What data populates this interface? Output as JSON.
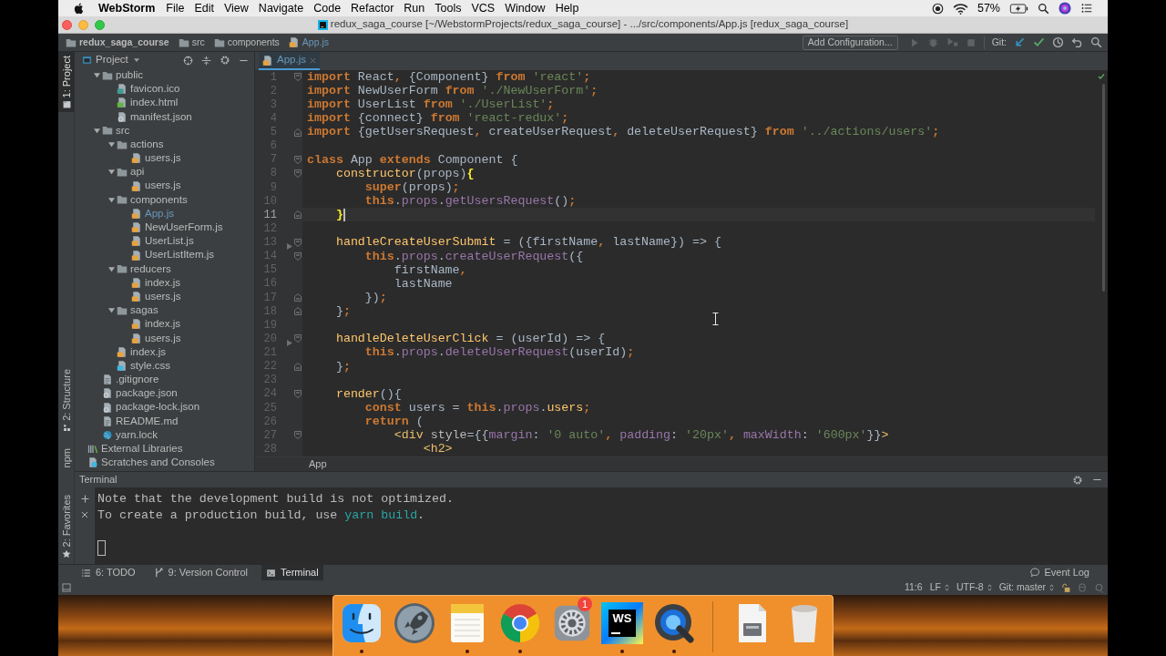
{
  "menu_bar": {
    "app_name": "WebStorm",
    "menus": [
      "File",
      "Edit",
      "View",
      "Navigate",
      "Code",
      "Refactor",
      "Run",
      "Tools",
      "VCS",
      "Window",
      "Help"
    ],
    "battery": "57%"
  },
  "window": {
    "title": "redux_saga_course [~/WebstormProjects/redux_saga_course] - .../src/components/App.js [redux_saga_course]"
  },
  "navigation_bar": {
    "breadcrumbs": [
      {
        "label": "redux_saga_course",
        "kind": "project",
        "modified": false
      },
      {
        "label": "src",
        "kind": "folder",
        "modified": false
      },
      {
        "label": "components",
        "kind": "folder",
        "modified": false
      },
      {
        "label": "App.js",
        "kind": "js",
        "modified": true
      }
    ],
    "run_configuration": "Add Configuration...",
    "git_label": "Git:"
  },
  "tool_stripe": {
    "top": [
      {
        "label": "1: Project",
        "kind": "project",
        "selected": true
      }
    ],
    "bottom": [
      {
        "label": "2: Structure",
        "kind": "structure",
        "selected": false
      },
      {
        "label": "npm",
        "kind": "npm",
        "selected": false
      }
    ],
    "lower": [
      {
        "label": "2: Favorites",
        "kind": "favorites",
        "selected": false
      }
    ]
  },
  "project_panel": {
    "title": "Project",
    "tree": [
      {
        "children": [
          {
            "name": "public",
            "kind": "folder",
            "expanded": true,
            "modified": false,
            "children": [
              {
                "name": "favicon.ico",
                "kind": "ico",
                "modified": false
              },
              {
                "name": "index.html",
                "kind": "html",
                "modified": false
              },
              {
                "name": "manifest.json",
                "kind": "json",
                "modified": false
              }
            ]
          },
          {
            "name": "src",
            "kind": "folder",
            "expanded": true,
            "modified": false,
            "children": [
              {
                "name": "actions",
                "kind": "folder",
                "expanded": true,
                "modified": false,
                "children": [
                  {
                    "name": "users.js",
                    "kind": "js",
                    "modified": false
                  }
                ]
              },
              {
                "name": "api",
                "kind": "folder",
                "expanded": true,
                "modified": false,
                "children": [
                  {
                    "name": "users.js",
                    "kind": "js",
                    "modified": false
                  }
                ]
              },
              {
                "name": "components",
                "kind": "folder",
                "expanded": true,
                "modified": false,
                "children": [
                  {
                    "name": "App.js",
                    "kind": "js",
                    "modified": true
                  },
                  {
                    "name": "NewUserForm.js",
                    "kind": "js",
                    "modified": false
                  },
                  {
                    "name": "UserList.js",
                    "kind": "js",
                    "modified": false
                  },
                  {
                    "name": "UserListItem.js",
                    "kind": "js",
                    "modified": false
                  }
                ]
              },
              {
                "name": "reducers",
                "kind": "folder",
                "expanded": true,
                "modified": false,
                "children": [
                  {
                    "name": "index.js",
                    "kind": "js",
                    "modified": false
                  },
                  {
                    "name": "users.js",
                    "kind": "js",
                    "modified": false
                  }
                ]
              },
              {
                "name": "sagas",
                "kind": "folder",
                "expanded": true,
                "modified": false,
                "children": [
                  {
                    "name": "index.js",
                    "kind": "js",
                    "modified": false
                  },
                  {
                    "name": "users.js",
                    "kind": "js",
                    "modified": false
                  }
                ]
              },
              {
                "name": "index.js",
                "kind": "js",
                "modified": false
              },
              {
                "name": "style.css",
                "kind": "css",
                "modified": false
              }
            ]
          },
          {
            "name": ".gitignore",
            "kind": "text",
            "modified": false
          },
          {
            "name": "package.json",
            "kind": "json",
            "modified": false
          },
          {
            "name": "package-lock.json",
            "kind": "json",
            "modified": false
          },
          {
            "name": "README.md",
            "kind": "text",
            "modified": false
          },
          {
            "name": "yarn.lock",
            "kind": "yarn",
            "modified": false
          }
        ]
      },
      {
        "name": "External Libraries",
        "kind": "libraries",
        "modified": false
      },
      {
        "name": "Scratches and Consoles",
        "kind": "scratches",
        "modified": false
      }
    ]
  },
  "editor": {
    "tabs": [
      {
        "label": "App.js",
        "kind": "js",
        "selected": true,
        "modified": true
      }
    ],
    "lines": [
      {
        "number": "1",
        "kind": "opener",
        "current": false,
        "tokens": [
          {
            "kind": "keyword",
            "text": "import"
          },
          {
            "kind": "plain",
            "text": " React"
          },
          {
            "kind": "keyword",
            "text": ","
          },
          {
            "kind": "plain",
            "text": " {Component} "
          },
          {
            "kind": "keyword",
            "text": "from "
          },
          {
            "kind": "string",
            "text": "'react'"
          },
          {
            "kind": "keyword",
            "text": ";"
          }
        ]
      },
      {
        "number": "2",
        "kind": "plain",
        "current": false,
        "tokens": [
          {
            "kind": "keyword",
            "text": "import"
          },
          {
            "kind": "plain",
            "text": " NewUserForm "
          },
          {
            "kind": "keyword",
            "text": "from "
          },
          {
            "kind": "string",
            "text": "'./NewUserForm'"
          },
          {
            "kind": "keyword",
            "text": ";"
          }
        ]
      },
      {
        "number": "3",
        "kind": "plain",
        "current": false,
        "tokens": [
          {
            "kind": "keyword",
            "text": "import"
          },
          {
            "kind": "plain",
            "text": " UserList "
          },
          {
            "kind": "keyword",
            "text": "from "
          },
          {
            "kind": "string",
            "text": "'./UserList'"
          },
          {
            "kind": "keyword",
            "text": ";"
          }
        ]
      },
      {
        "number": "4",
        "kind": "plain",
        "current": false,
        "tokens": [
          {
            "kind": "keyword",
            "text": "import"
          },
          {
            "kind": "plain",
            "text": " {connect} "
          },
          {
            "kind": "keyword",
            "text": "from "
          },
          {
            "kind": "string",
            "text": "'react-redux'"
          },
          {
            "kind": "keyword",
            "text": ";"
          }
        ]
      },
      {
        "number": "5",
        "kind": "closer",
        "current": false,
        "tokens": [
          {
            "kind": "keyword",
            "text": "import"
          },
          {
            "kind": "plain",
            "text": " {getUsersRequest"
          },
          {
            "kind": "keyword",
            "text": ","
          },
          {
            "kind": "plain",
            "text": " createUserRequest"
          },
          {
            "kind": "keyword",
            "text": ","
          },
          {
            "kind": "plain",
            "text": " deleteUserRequest} "
          },
          {
            "kind": "keyword",
            "text": "from "
          },
          {
            "kind": "string",
            "text": "'../actions/users'"
          },
          {
            "kind": "keyword",
            "text": ";"
          }
        ]
      },
      {
        "number": "6",
        "kind": "plain",
        "current": false
      },
      {
        "number": "7",
        "kind": "opener",
        "current": false,
        "tokens": [
          {
            "kind": "keyword",
            "text": "class"
          },
          {
            "kind": "plain",
            "text": " App "
          },
          {
            "kind": "keyword",
            "text": "extends"
          },
          {
            "kind": "plain",
            "text": " Component {"
          }
        ]
      },
      {
        "number": "8",
        "kind": "opener",
        "current": false,
        "tokens": [
          {
            "kind": "method",
            "text": "    constructor"
          },
          {
            "kind": "plain",
            "text": "(props)"
          },
          {
            "kind": "match",
            "text": "{"
          }
        ]
      },
      {
        "number": "9",
        "kind": "plain",
        "current": false,
        "tokens": [
          {
            "kind": "keyword",
            "text": "        super"
          },
          {
            "kind": "plain",
            "text": "(props)"
          },
          {
            "kind": "keyword",
            "text": ";"
          }
        ]
      },
      {
        "number": "10",
        "kind": "plain",
        "current": false,
        "tokens": [
          {
            "kind": "keyword",
            "text": "        this"
          },
          {
            "kind": "plain",
            "text": "."
          },
          {
            "kind": "member",
            "text": "props"
          },
          {
            "kind": "plain",
            "text": "."
          },
          {
            "kind": "member",
            "text": "getUsersRequest"
          },
          {
            "kind": "plain",
            "text": "()"
          },
          {
            "kind": "keyword",
            "text": ";"
          }
        ]
      },
      {
        "number": "11",
        "kind": "closer",
        "current": true,
        "tokens": [
          {
            "kind": "match",
            "text": "    }"
          }
        ]
      },
      {
        "number": "12",
        "kind": "plain",
        "current": false
      },
      {
        "number": "13",
        "kind": "method",
        "current": false,
        "tokens": [
          {
            "kind": "method",
            "text": "    handleCreateUserSubmit"
          },
          {
            "kind": "plain",
            "text": " = ({firstName"
          },
          {
            "kind": "keyword",
            "text": ","
          },
          {
            "kind": "plain",
            "text": " lastName}) => {"
          }
        ]
      },
      {
        "number": "14",
        "kind": "opener",
        "current": false,
        "tokens": [
          {
            "kind": "keyword",
            "text": "        this"
          },
          {
            "kind": "plain",
            "text": "."
          },
          {
            "kind": "member",
            "text": "props"
          },
          {
            "kind": "plain",
            "text": "."
          },
          {
            "kind": "member",
            "text": "createUserRequest"
          },
          {
            "kind": "plain",
            "text": "({"
          }
        ]
      },
      {
        "number": "15",
        "kind": "plain",
        "current": false,
        "tokens": [
          {
            "kind": "plain",
            "text": "            firstName"
          },
          {
            "kind": "keyword",
            "text": ","
          }
        ]
      },
      {
        "number": "16",
        "kind": "plain",
        "current": false,
        "tokens": [
          {
            "kind": "plain",
            "text": "            lastName"
          }
        ]
      },
      {
        "number": "17",
        "kind": "closer",
        "current": false,
        "tokens": [
          {
            "kind": "plain",
            "text": "        })"
          },
          {
            "kind": "keyword",
            "text": ";"
          }
        ]
      },
      {
        "number": "18",
        "kind": "closer",
        "current": false,
        "tokens": [
          {
            "kind": "plain",
            "text": "    }"
          },
          {
            "kind": "keyword",
            "text": ";"
          }
        ]
      },
      {
        "number": "19",
        "kind": "plain",
        "current": false
      },
      {
        "number": "20",
        "kind": "method",
        "current": false,
        "tokens": [
          {
            "kind": "method",
            "text": "    handleDeleteUserClick"
          },
          {
            "kind": "plain",
            "text": " = (userId) => {"
          }
        ]
      },
      {
        "number": "21",
        "kind": "plain",
        "current": false,
        "tokens": [
          {
            "kind": "keyword",
            "text": "        this"
          },
          {
            "kind": "plain",
            "text": "."
          },
          {
            "kind": "member",
            "text": "props"
          },
          {
            "kind": "plain",
            "text": "."
          },
          {
            "kind": "member",
            "text": "deleteUserRequest"
          },
          {
            "kind": "plain",
            "text": "(userId)"
          },
          {
            "kind": "keyword",
            "text": ";"
          }
        ]
      },
      {
        "number": "22",
        "kind": "closer",
        "current": false,
        "tokens": [
          {
            "kind": "plain",
            "text": "    }"
          },
          {
            "kind": "keyword",
            "text": ";"
          }
        ]
      },
      {
        "number": "23",
        "kind": "plain",
        "current": false
      },
      {
        "number": "24",
        "kind": "opener",
        "current": false,
        "tokens": [
          {
            "kind": "method",
            "text": "    render"
          },
          {
            "kind": "plain",
            "text": "(){"
          }
        ]
      },
      {
        "number": "25",
        "kind": "plain",
        "current": false,
        "tokens": [
          {
            "kind": "keyword",
            "text": "        const"
          },
          {
            "kind": "plain",
            "text": " users = "
          },
          {
            "kind": "keyword",
            "text": "this"
          },
          {
            "kind": "plain",
            "text": "."
          },
          {
            "kind": "member",
            "text": "props"
          },
          {
            "kind": "plain",
            "text": "."
          },
          {
            "kind": "method",
            "text": "users"
          },
          {
            "kind": "keyword",
            "text": ";"
          }
        ]
      },
      {
        "number": "26",
        "kind": "plain",
        "current": false,
        "tokens": [
          {
            "kind": "keyword",
            "text": "        return"
          },
          {
            "kind": "plain",
            "text": " ("
          }
        ]
      },
      {
        "number": "27",
        "kind": "opener",
        "current": false,
        "tokens": [
          {
            "kind": "tag",
            "text": "            <div"
          },
          {
            "kind": "attr",
            "text": " style"
          },
          {
            "kind": "plain",
            "text": "={{"
          },
          {
            "kind": "member",
            "text": "margin"
          },
          {
            "kind": "plain",
            "text": ": "
          },
          {
            "kind": "string",
            "text": "'0 auto'"
          },
          {
            "kind": "keyword",
            "text": ","
          },
          {
            "kind": "member",
            "text": " padding"
          },
          {
            "kind": "plain",
            "text": ": "
          },
          {
            "kind": "string",
            "text": "'20px'"
          },
          {
            "kind": "keyword",
            "text": ","
          },
          {
            "kind": "member",
            "text": " maxWidth"
          },
          {
            "kind": "plain",
            "text": ": "
          },
          {
            "kind": "string",
            "text": "'600px'"
          },
          {
            "kind": "plain",
            "text": "}}"
          },
          {
            "kind": "tag",
            "text": ">"
          }
        ]
      },
      {
        "number": "28",
        "kind": "plain",
        "current": false,
        "tokens": [
          {
            "kind": "tag",
            "text": "                <h2>"
          }
        ]
      }
    ],
    "breadcrumb": "App"
  },
  "terminal": {
    "title": "Terminal",
    "lines": [
      {
        "segments": [
          {
            "kind": "plain",
            "text": "Note that the development build is not optimized."
          }
        ]
      },
      {
        "segments": [
          {
            "kind": "plain",
            "text": "To create a production build, use "
          },
          {
            "kind": "command",
            "text": "yarn build"
          },
          {
            "kind": "plain",
            "text": "."
          }
        ]
      }
    ]
  },
  "bottom_bar": {
    "tabs": [
      {
        "label": "6: TODO",
        "kind": "todo",
        "selected": false
      },
      {
        "label": "9: Version Control",
        "kind": "vcs",
        "selected": false
      },
      {
        "label": "Terminal",
        "kind": "terminal",
        "selected": true
      }
    ],
    "event_log": "Event Log"
  },
  "status_bar": {
    "position": "11:6",
    "line_separator": "LF",
    "encoding": "UTF-8",
    "branch": "Git: master"
  },
  "dock": {
    "apps": [
      {
        "kind": "finder",
        "running": true
      },
      {
        "kind": "launchpad",
        "running": false
      },
      {
        "kind": "notes",
        "running": true
      },
      {
        "kind": "browser",
        "running": true
      },
      {
        "kind": "preferences",
        "running": false,
        "badge": "1"
      },
      {
        "kind": "webstorm",
        "running": true,
        "label": "WS"
      },
      {
        "kind": "quicktime",
        "running": true
      }
    ],
    "documents": [
      {
        "kind": "disk-image"
      },
      {
        "kind": "trash"
      }
    ]
  }
}
